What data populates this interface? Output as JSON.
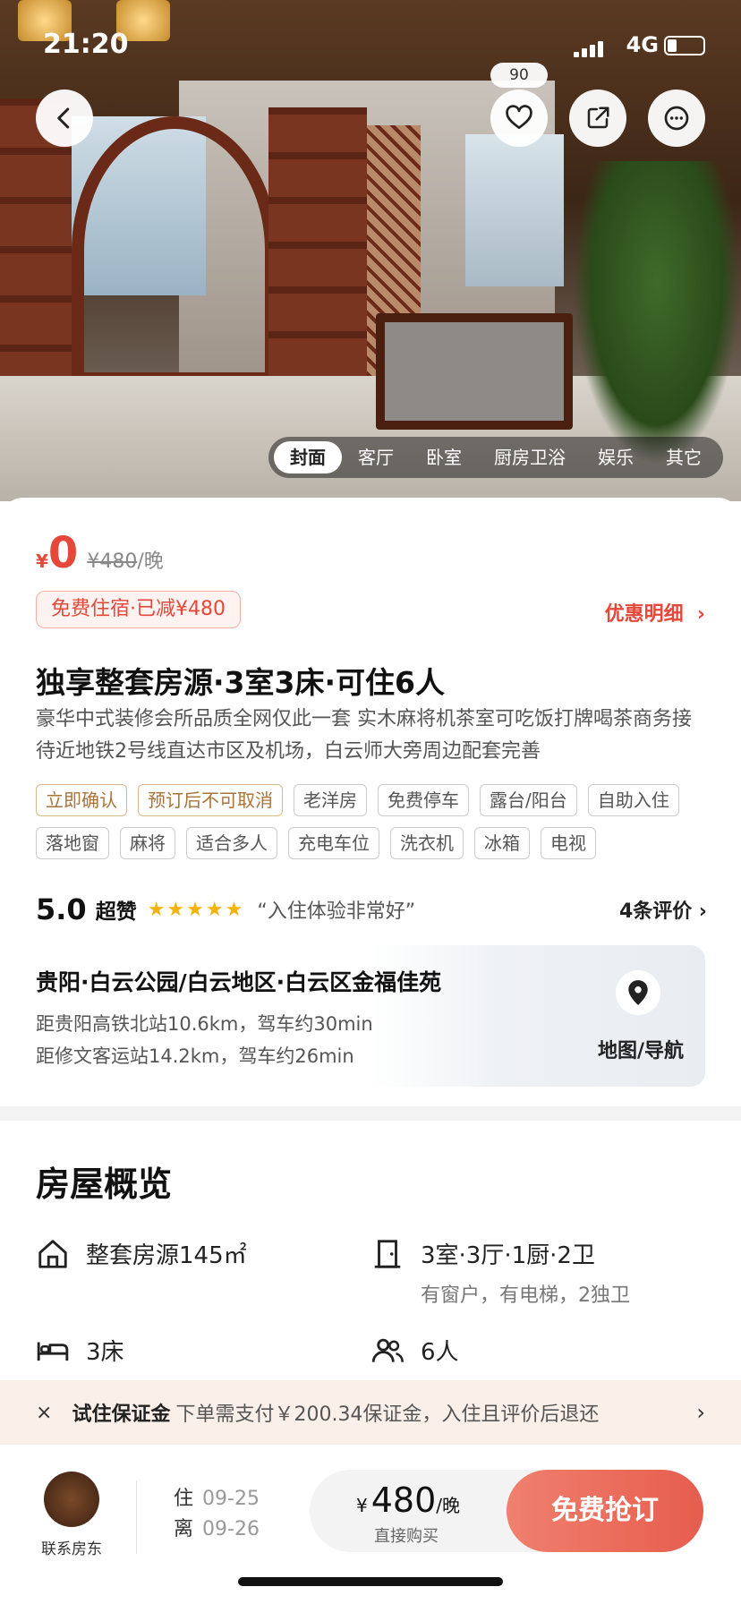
{
  "status_bar": {
    "time": "21:20",
    "network": "4G"
  },
  "hero": {
    "favorite_count": "90",
    "photo_tabs": [
      "封面",
      "客厅",
      "卧室",
      "厨房卫浴",
      "娱乐",
      "其它"
    ]
  },
  "price": {
    "currency": "¥",
    "current": "0",
    "original": "¥480",
    "unit": "/晚",
    "badge": "免费住宿·已减¥480",
    "discount_link": "优惠明细"
  },
  "listing": {
    "title": "独享整套房源·3室3床·可住6人",
    "description": "豪华中式装修会所品质全网仅此一套 实木麻将机茶室可吃饭打牌喝茶商务接待近地铁2号线直达市区及机场，白云师大旁周边配套完善",
    "tags": [
      "立即确认",
      "预订后不可取消",
      "老洋房",
      "免费停车",
      "露台/阳台",
      "自助入住",
      "落地窗",
      "麻将",
      "适合多人",
      "充电车位",
      "洗衣机",
      "冰箱",
      "电视"
    ]
  },
  "rating": {
    "score": "5.0",
    "label": "超赞",
    "stars": 5,
    "quote": "“入住体验非常好”",
    "reviews": "4条评价"
  },
  "location": {
    "address": "贵阳·白云公园/白云地区·白云区金福佳苑",
    "distance_1": "距贵阳高铁北站10.6km，驾车约30min",
    "distance_2": "距修文客运站14.2km，驾车约26min",
    "map_label": "地图/导航"
  },
  "overview": {
    "title": "房屋概览",
    "area": "整套房源145㎡",
    "layout": "3室·3厅·1厨·2卫",
    "layout_sub": "有窗户，有电梯，2独卫",
    "beds": "3床",
    "guests": "6人"
  },
  "deposit": {
    "close": "×",
    "title": "试住保证金",
    "text": "下单需支付￥200.34保证金，入住且评价后退还"
  },
  "bottom_bar": {
    "host_label": "联系房东",
    "checkin_label": "住",
    "checkin_date": "09-25",
    "checkout_label": "离",
    "checkout_date": "09-26",
    "price_currency": "¥",
    "price": "480",
    "price_unit": "/晚",
    "buy_direct": "直接购买",
    "book_button": "免费抢订"
  },
  "colors": {
    "accent": "#e5483b",
    "star": "#f5b30a",
    "tag_gold": "#a8743a"
  }
}
